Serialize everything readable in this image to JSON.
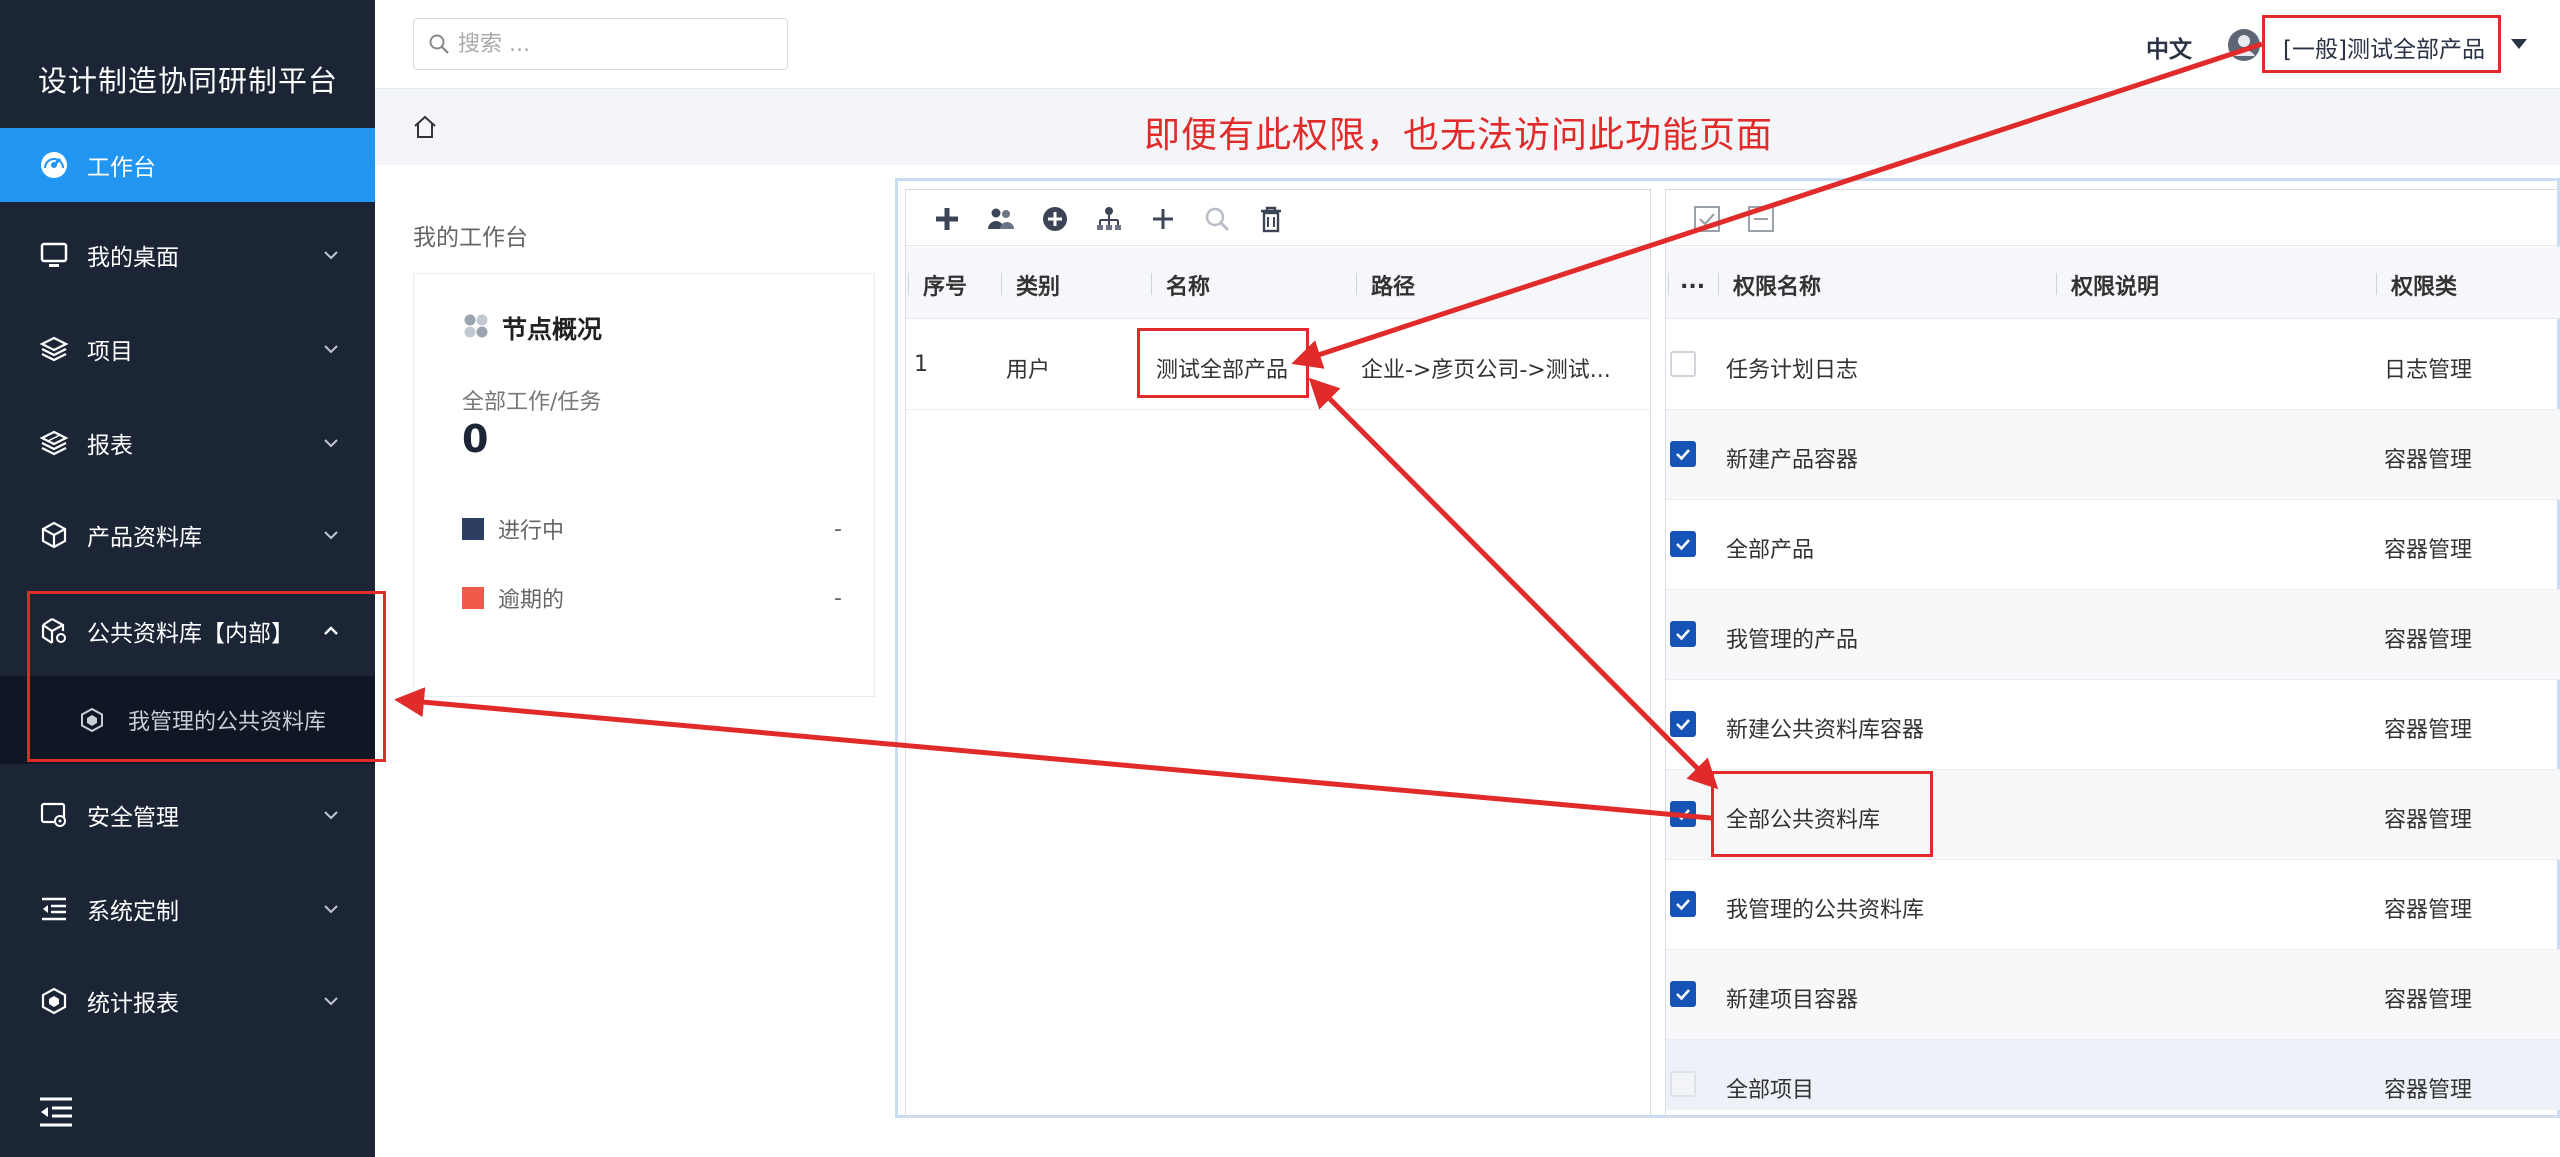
{
  "app": {
    "title": "设计制造协同研制平台"
  },
  "sidebar": {
    "items": [
      {
        "label": "工作台",
        "icon": "dashboard-icon",
        "active": true
      },
      {
        "label": "我的桌面",
        "icon": "monitor-icon"
      },
      {
        "label": "项目",
        "icon": "layers-icon"
      },
      {
        "label": "报表",
        "icon": "layers-stack-icon"
      },
      {
        "label": "产品资料库",
        "icon": "cube-icon"
      },
      {
        "label": "公共资料库【内部】",
        "icon": "cube-gear-icon",
        "expanded": true
      },
      {
        "label": "安全管理",
        "icon": "security-icon"
      },
      {
        "label": "系统定制",
        "icon": "indent-icon"
      },
      {
        "label": "统计报表",
        "icon": "hexagon-icon"
      }
    ],
    "sub_item": {
      "label": "我管理的公共资料库",
      "icon": "hexagon-small-icon"
    }
  },
  "header": {
    "search_placeholder": "搜索 ...",
    "language": "中文",
    "user_name": "[一般]测试全部产品"
  },
  "workspace": {
    "title": "我的工作台",
    "card": {
      "title": "节点概况",
      "subtitle": "全部工作/任务",
      "count": "0",
      "legend": [
        {
          "label": "进行中",
          "value": "-",
          "color": "#2d3e63"
        },
        {
          "label": "逾期的",
          "value": "-",
          "color": "#f05a4a"
        }
      ]
    }
  },
  "annotation": {
    "text": "即便有此权限，也无法访问此功能页面"
  },
  "left_table": {
    "columns": [
      "序号",
      "类别",
      "名称",
      "路径"
    ],
    "rows": [
      {
        "index": "1",
        "category": "用户",
        "name": "测试全部产品",
        "path": "企业->彦页公司->测试..."
      }
    ]
  },
  "right_table": {
    "columns": [
      "...",
      "权限名称",
      "权限说明",
      "权限类"
    ],
    "rows": [
      {
        "checked": "off",
        "name": "任务计划日志",
        "desc": "",
        "type": "日志管理"
      },
      {
        "checked": "on",
        "name": "新建产品容器",
        "desc": "",
        "type": "容器管理"
      },
      {
        "checked": "on",
        "name": "全部产品",
        "desc": "",
        "type": "容器管理"
      },
      {
        "checked": "on",
        "name": "我管理的产品",
        "desc": "",
        "type": "容器管理"
      },
      {
        "checked": "on",
        "name": "新建公共资料库容器",
        "desc": "",
        "type": "容器管理"
      },
      {
        "checked": "on",
        "name": "全部公共资料库",
        "desc": "",
        "type": "容器管理"
      },
      {
        "checked": "on",
        "name": "我管理的公共资料库",
        "desc": "",
        "type": "容器管理"
      },
      {
        "checked": "on",
        "name": "新建项目容器",
        "desc": "",
        "type": "容器管理"
      },
      {
        "checked": "dis",
        "name": "全部项目",
        "desc": "",
        "type": "容器管理"
      }
    ]
  },
  "colors": {
    "sidebar_bg": "#1b2535",
    "active": "#2196f3",
    "annotation": "#e12a2a",
    "checkbox": "#1653b6"
  }
}
